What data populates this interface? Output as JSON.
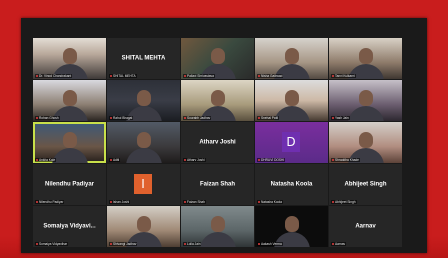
{
  "meeting": {
    "participants": [
      {
        "name": "",
        "label": "Dr. Vinod Chandrakant",
        "video": true,
        "bg": "v1"
      },
      {
        "name": "SHITAL MEHTA",
        "label": "SHITAL MEHTA",
        "video": false
      },
      {
        "name": "",
        "label": "Pallavi Shrivastava",
        "video": true,
        "bg": "v3"
      },
      {
        "name": "",
        "label": "Nisha Gaikwad",
        "video": true,
        "bg": "v4"
      },
      {
        "name": "",
        "label": "Tanvi Kulkarni",
        "video": true,
        "bg": "v5"
      },
      {
        "name": "",
        "label": "Rohan Ghosh",
        "video": true,
        "bg": "v6"
      },
      {
        "name": "",
        "label": "Rahul Bhagat",
        "video": true,
        "bg": "v7"
      },
      {
        "name": "",
        "label": "Sourabh Jadhav",
        "video": true,
        "bg": "v8"
      },
      {
        "name": "",
        "label": "Snehal Patil",
        "video": true,
        "bg": "v9"
      },
      {
        "name": "",
        "label": "Yash Jain",
        "video": true,
        "bg": "v10"
      },
      {
        "name": "",
        "label": "Ankita Kale",
        "video": true,
        "bg": "v11",
        "active": true
      },
      {
        "name": "",
        "label": "Aditi",
        "video": true,
        "bg": "v12"
      },
      {
        "name": "Atharv Joshi",
        "label": "Atharv Joshi",
        "video": false
      },
      {
        "name": "",
        "label": "DHRUVI DOSHI",
        "video": false,
        "avatar": "D",
        "avatar_color": "purple",
        "bg": "v15"
      },
      {
        "name": "",
        "label": "Shraddha Khade",
        "video": true,
        "bg": "v16"
      },
      {
        "name": "Nilendhu Padiyar",
        "label": "Nilendhu Padiyar",
        "video": false
      },
      {
        "name": "",
        "label": "Ishan Joshi",
        "video": false,
        "avatar": "I",
        "avatar_color": "orange"
      },
      {
        "name": "Faizan Shah",
        "label": "Faizan Shah",
        "video": false
      },
      {
        "name": "Natasha Koola",
        "label": "Natasha Koola",
        "video": false
      },
      {
        "name": "Abhijeet Singh",
        "label": "Abhijeet Singh",
        "video": false
      },
      {
        "name": "Somaiya Vidyavi...",
        "label": "Somaiya Vidyavihar",
        "video": false
      },
      {
        "name": "",
        "label": "Shivangi Jadhav",
        "video": true,
        "bg": "v22"
      },
      {
        "name": "",
        "label": "Lolla Jain",
        "video": true,
        "bg": "v23"
      },
      {
        "name": "",
        "label": "Aakash Verma",
        "video": true,
        "bg": "v24"
      },
      {
        "name": "Aarnav",
        "label": "Aarnav",
        "video": false
      }
    ]
  },
  "colors": {
    "background_panel": "#c91d1d",
    "meeting_background": "#1a1a1a",
    "tile_background": "#262626",
    "active_speaker_outline": "#c8e04a",
    "muted_mic": "#e34040"
  }
}
